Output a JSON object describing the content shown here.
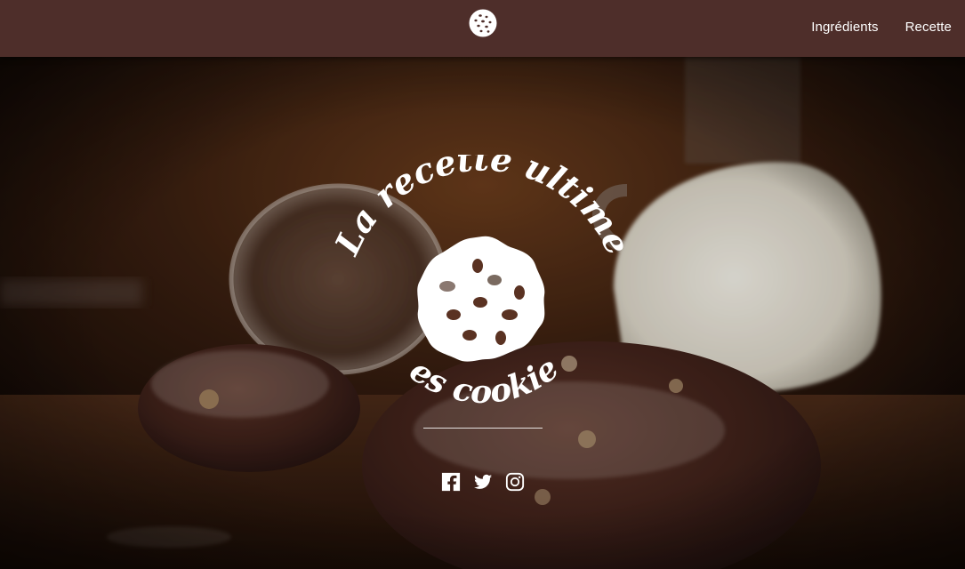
{
  "nav": {
    "logo_icon": "cookie-icon",
    "links": [
      {
        "label": "Ingrédients"
      },
      {
        "label": "Recette"
      }
    ]
  },
  "hero": {
    "title_arc": "La recette ultime",
    "subtitle_arc": "des cookies",
    "emblem_icon": "cookie-icon",
    "social": [
      {
        "icon": "facebook-icon"
      },
      {
        "icon": "twitter-icon"
      },
      {
        "icon": "instagram-icon"
      }
    ]
  },
  "colors": {
    "navbar": "#4e2e2a",
    "text": "#ffffff"
  }
}
